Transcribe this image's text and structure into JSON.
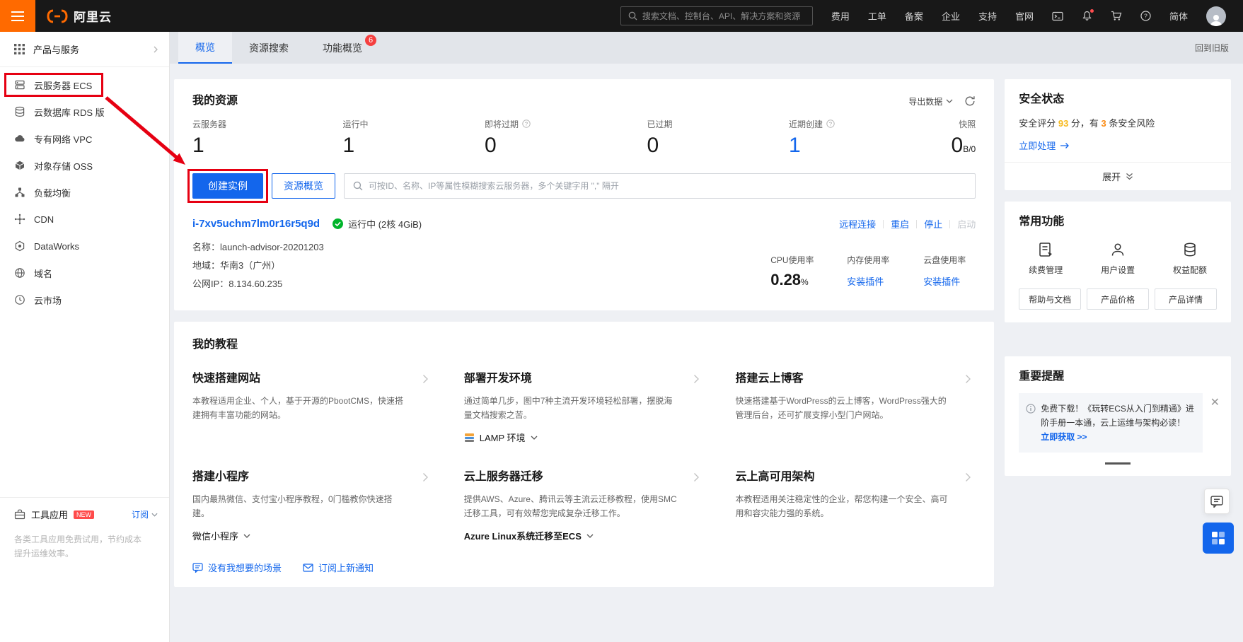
{
  "topbar": {
    "brand": "阿里云",
    "search_placeholder": "搜索文档、控制台、API、解决方案和资源",
    "nav": [
      "费用",
      "工单",
      "备案",
      "企业",
      "支持",
      "官网"
    ],
    "lang": "简体"
  },
  "sidebar": {
    "products_label": "产品与服务",
    "items": [
      {
        "label": "云服务器 ECS"
      },
      {
        "label": "云数据库 RDS 版"
      },
      {
        "label": "专有网络 VPC"
      },
      {
        "label": "对象存储 OSS"
      },
      {
        "label": "负载均衡"
      },
      {
        "label": "CDN"
      },
      {
        "label": "DataWorks"
      },
      {
        "label": "域名"
      },
      {
        "label": "云市场"
      }
    ],
    "tools": {
      "label": "工具应用",
      "badge": "NEW",
      "subscribe_label": "订阅",
      "description": "各类工具应用免费试用，节约成本提升运维效率。"
    }
  },
  "tabs": {
    "overview": "概览",
    "resource_search": "资源搜索",
    "feature_overview": "功能概览",
    "feature_badge": "6",
    "back_link": "回到旧版"
  },
  "resources": {
    "title": "我的资源",
    "export_label": "导出数据",
    "stats": [
      {
        "label": "云服务器",
        "value": "1"
      },
      {
        "label": "运行中",
        "value": "1"
      },
      {
        "label": "即将过期",
        "value": "0"
      },
      {
        "label": "已过期",
        "value": "0"
      },
      {
        "label": "近期创建",
        "value": "1"
      },
      {
        "label": "快照",
        "value": "0",
        "suffix": "B/0"
      }
    ],
    "create_button": "创建实例",
    "overview_button": "资源概览",
    "search_placeholder": "可按ID、名称、IP等属性模糊搜索云服务器，多个关键字用 \",\" 隔开",
    "instance": {
      "id": "i-7xv5uchm7lm0r16r5q9d",
      "status": "运行中 (2核 4GiB)",
      "name_label": "名称：",
      "name": "launch-advisor-20201203",
      "region_label": "地域：",
      "region": "华南3（广州）",
      "ip_label": "公网IP：",
      "ip": "8.134.60.235",
      "actions": [
        "远程连接",
        "重启",
        "停止",
        "启动"
      ],
      "metrics": {
        "cpu_label": "CPU使用率",
        "cpu_value": "0.28",
        "cpu_unit": "%",
        "mem_label": "内存使用率",
        "mem_link": "安装插件",
        "disk_label": "云盘使用率",
        "disk_link": "安装插件"
      }
    }
  },
  "tutorials": {
    "title": "我的教程",
    "items": [
      {
        "title": "快速搭建网站",
        "desc": "本教程适用企业、个人，基于开源的PbootCMS，快速搭建拥有丰富功能的网站。"
      },
      {
        "title": "部署开发环境",
        "desc": "通过简单几步，图中7种主流开发环境轻松部署，摆脱海量文档搜索之苦。",
        "dropdown": "LAMP 环境"
      },
      {
        "title": "搭建云上博客",
        "desc": "快速搭建基于WordPress的云上博客，WordPress强大的管理后台，还可扩展支撑小型门户网站。"
      },
      {
        "title": "搭建小程序",
        "desc": "国内最热微信、支付宝小程序教程，0门槛教你快速搭建。",
        "dropdown": "微信小程序"
      },
      {
        "title": "云上服务器迁移",
        "desc": "提供AWS、Azure、腾讯云等主流云迁移教程，使用SMC迁移工具，可有效帮您完成复杂迁移工作。",
        "dropdown": "Azure Linux系统迁移至ECS"
      },
      {
        "title": "云上高可用架构",
        "desc": "本教程适用关注稳定性的企业，帮您构建一个安全、高可用和容灾能力强的系统。"
      }
    ],
    "footer": [
      "没有我想要的场景",
      "订阅上新通知"
    ]
  },
  "security": {
    "title": "安全状态",
    "prefix": "安全评分 ",
    "score": "93",
    "mid": " 分，有 ",
    "count": "3",
    "suffix": " 条安全风险",
    "action": "立即处理",
    "expand": "展开"
  },
  "common": {
    "title": "常用功能",
    "features": [
      {
        "label": "续费管理"
      },
      {
        "label": "用户设置"
      },
      {
        "label": "权益配额"
      }
    ],
    "buttons": [
      "帮助与文档",
      "产品价格",
      "产品详情"
    ]
  },
  "notice": {
    "title": "重要提醒",
    "text": "免费下载！《玩转ECS从入门到精通》进阶手册一本通，云上运维与架构必读！ ",
    "link": "立即获取 >>"
  }
}
